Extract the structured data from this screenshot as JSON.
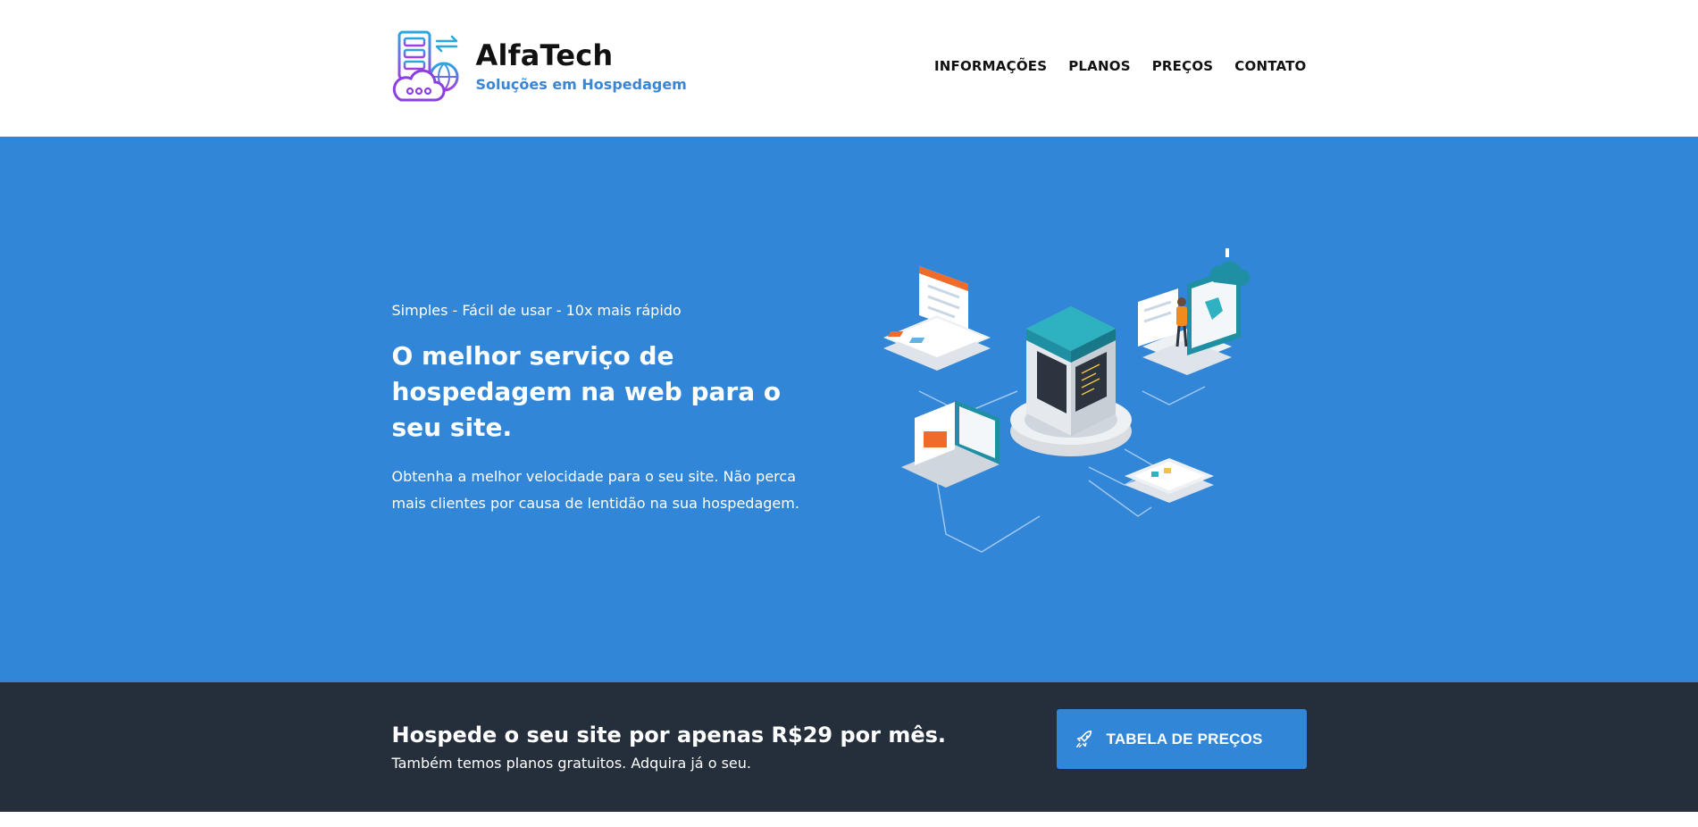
{
  "brand": {
    "name": "AlfaTech",
    "tagline": "Soluções em Hospedagem"
  },
  "nav": {
    "items": [
      {
        "label": "INFORMAÇÕES"
      },
      {
        "label": "PLANOS"
      },
      {
        "label": "PREÇOS"
      },
      {
        "label": "CONTATO"
      }
    ]
  },
  "hero": {
    "eyebrow": "Simples - Fácil de usar - 10x mais rápido",
    "title": "O melhor serviço de hospedagem na web para o seu site.",
    "description": "Obtenha a melhor velocidade para o seu site. Não perca mais clientes por causa de lentidão na sua hospedagem.",
    "illustration_icon": "server-network-illustration"
  },
  "cta": {
    "title": "Hospede o seu site por apenas R$29 por mês.",
    "subtitle": "Também temos planos gratuitos. Adquira já o seu.",
    "button_label": "TABELA DE PREÇOS",
    "button_icon": "rocket-icon"
  },
  "colors": {
    "accent": "#3186d8",
    "dark": "#252f3c",
    "brand_blue": "#3a86d6"
  }
}
